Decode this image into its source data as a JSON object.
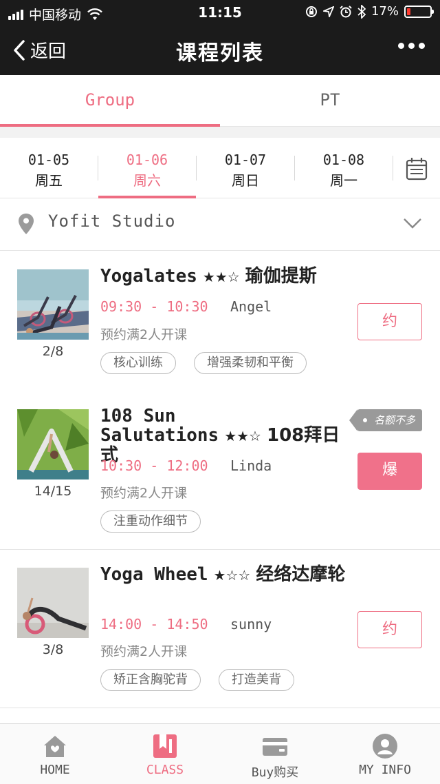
{
  "status_bar": {
    "carrier": "中国移动",
    "time": "11:15",
    "battery_percent": "17%",
    "battery_level": 0.17,
    "icons": [
      "signal-icon",
      "wifi-icon",
      "rotation-lock-icon",
      "location-icon",
      "alarm-icon",
      "bluetooth-icon",
      "battery-icon"
    ]
  },
  "nav": {
    "back_label": "返回",
    "title": "课程列表",
    "more_icon": "more-icon"
  },
  "top_tabs": [
    {
      "label": "Group",
      "active": true
    },
    {
      "label": "PT",
      "active": false
    }
  ],
  "dates": [
    {
      "date": "01-05",
      "weekday": "周五",
      "active": false
    },
    {
      "date": "01-06",
      "weekday": "周六",
      "active": true
    },
    {
      "date": "01-07",
      "weekday": "周日",
      "active": false
    },
    {
      "date": "01-08",
      "weekday": "周一",
      "active": false
    }
  ],
  "location": {
    "studio": "Yofit Studio"
  },
  "classes": [
    {
      "title_en": "Yogalates",
      "stars": "★★☆",
      "title_cn": "瑜伽提斯",
      "time": "09:30 - 10:30",
      "coach": "Angel",
      "note": "预约满2人开课",
      "capacity": "2/8",
      "tags": [
        "核心训练",
        "增强柔韧和平衡"
      ],
      "button": "约",
      "button_style": "outline",
      "badge": ""
    },
    {
      "title_en": "108 Sun Salutations",
      "stars": "★★☆",
      "title_cn": "108拜日式",
      "time": "10:30 - 12:00",
      "coach": "Linda",
      "note": "预约满2人开课",
      "capacity": "14/15",
      "tags": [
        "注重动作细节"
      ],
      "button": "爆",
      "button_style": "full",
      "badge": "名额不多"
    },
    {
      "title_en": "Yoga Wheel",
      "stars": "★☆☆",
      "title_cn": "经络达摩轮",
      "time": "14:00 - 14:50",
      "coach": "sunny",
      "note": "预约满2人开课",
      "capacity": "3/8",
      "tags": [
        "矫正含胸驼背",
        "打造美背"
      ],
      "button": "约",
      "button_style": "outline",
      "badge": ""
    }
  ],
  "tab_bar": [
    {
      "label": "HOME",
      "icon": "home-icon",
      "active": false
    },
    {
      "label": "CLASS",
      "icon": "bookmark-icon",
      "active": true
    },
    {
      "label": "Buy购买",
      "icon": "wallet-icon",
      "active": false
    },
    {
      "label": "MY INFO",
      "icon": "user-icon",
      "active": false
    }
  ],
  "colors": {
    "accent": "#ee6d82",
    "nav_bg": "#1b1b1b"
  }
}
